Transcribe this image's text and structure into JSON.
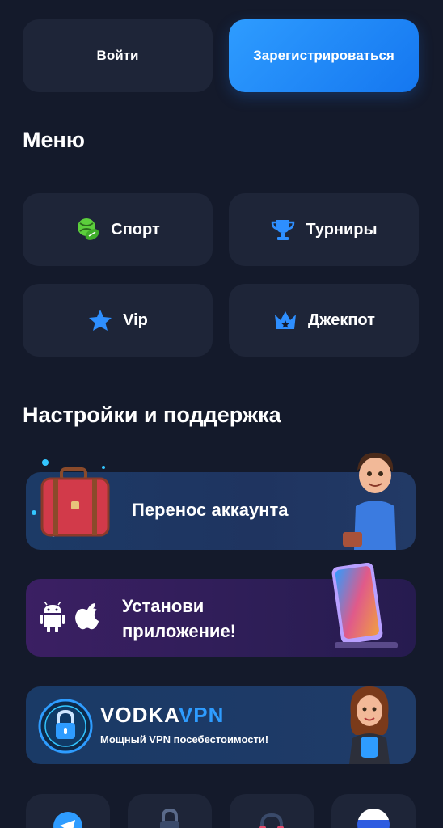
{
  "auth": {
    "login_label": "Войти",
    "register_label": "Зарегистрироваться"
  },
  "menu": {
    "title": "Меню",
    "items": [
      {
        "label": "Спорт",
        "icon": "sport-ball-icon"
      },
      {
        "label": "Турниры",
        "icon": "trophy-icon"
      },
      {
        "label": "Vip",
        "icon": "star-icon"
      },
      {
        "label": "Джекпот",
        "icon": "crown-icon"
      }
    ]
  },
  "support": {
    "title": "Настройки и поддержка",
    "banners": {
      "transfer": {
        "label": "Перенос аккаунта"
      },
      "app": {
        "line1": "Установи",
        "line2": "приложение!"
      },
      "vpn": {
        "brand_part1": "VODKA",
        "brand_part2": "VPN",
        "subtitle": "Мощный VPN посебестоимости!"
      }
    }
  },
  "colors": {
    "background": "#141a2b",
    "tile": "#1e2538",
    "accent_blue": "#2e9cff",
    "sport_green": "#5ccf3c"
  },
  "bottom_icons": [
    "telegram-icon",
    "lock-icon",
    "headset-icon",
    "language-flag-icon"
  ]
}
